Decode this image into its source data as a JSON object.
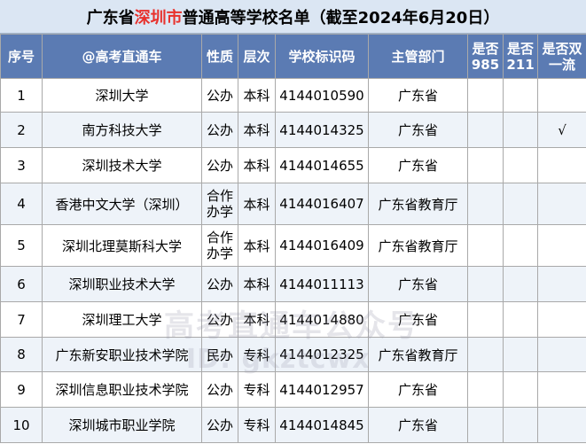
{
  "title": {
    "prefix": "广东省",
    "highlight": "深圳市",
    "suffix": "普通高等学校名单（截至2024年6月20日）"
  },
  "columns": [
    "序号",
    "@高考直通车",
    "性质",
    "层次",
    "学校标识码",
    "主管部门",
    "是否985",
    "是否211",
    "是否双一流"
  ],
  "rows": [
    {
      "no": "1",
      "name": "深圳大学",
      "type": "公办",
      "level": "本科",
      "code": "4144010590",
      "dept": "广东省",
      "is985": "",
      "is211": "",
      "dbl": ""
    },
    {
      "no": "2",
      "name": "南方科技大学",
      "type": "公办",
      "level": "本科",
      "code": "4144014325",
      "dept": "广东省",
      "is985": "",
      "is211": "",
      "dbl": "√"
    },
    {
      "no": "3",
      "name": "深圳技术大学",
      "type": "公办",
      "level": "本科",
      "code": "4144014655",
      "dept": "广东省",
      "is985": "",
      "is211": "",
      "dbl": ""
    },
    {
      "no": "4",
      "name": "香港中文大学（深圳）",
      "type": "合作办学",
      "level": "本科",
      "code": "4144016407",
      "dept": "广东省教育厅",
      "is985": "",
      "is211": "",
      "dbl": ""
    },
    {
      "no": "5",
      "name": "深圳北理莫斯科大学",
      "type": "合作办学",
      "level": "本科",
      "code": "4144016409",
      "dept": "广东省教育厅",
      "is985": "",
      "is211": "",
      "dbl": ""
    },
    {
      "no": "6",
      "name": "深圳职业技术大学",
      "type": "公办",
      "level": "本科",
      "code": "4144011113",
      "dept": "广东省",
      "is985": "",
      "is211": "",
      "dbl": ""
    },
    {
      "no": "7",
      "name": "深圳理工大学",
      "type": "公办",
      "level": "本科",
      "code": "4144014880",
      "dept": "广东省",
      "is985": "",
      "is211": "",
      "dbl": ""
    },
    {
      "no": "8",
      "name": "广东新安职业技术学院",
      "type": "民办",
      "level": "专科",
      "code": "4144012325",
      "dept": "广东省教育厅",
      "is985": "",
      "is211": "",
      "dbl": ""
    },
    {
      "no": "9",
      "name": "深圳信息职业技术学院",
      "type": "公办",
      "level": "专科",
      "code": "4144012957",
      "dept": "广东省",
      "is985": "",
      "is211": "",
      "dbl": ""
    },
    {
      "no": "10",
      "name": "深圳城市职业学院",
      "type": "公办",
      "level": "专科",
      "code": "4144014845",
      "dept": "广东省",
      "is985": "",
      "is211": "",
      "dbl": ""
    }
  ],
  "watermark": {
    "line1": "高考直通车公众号",
    "line2": "ID: gkztcwx"
  }
}
